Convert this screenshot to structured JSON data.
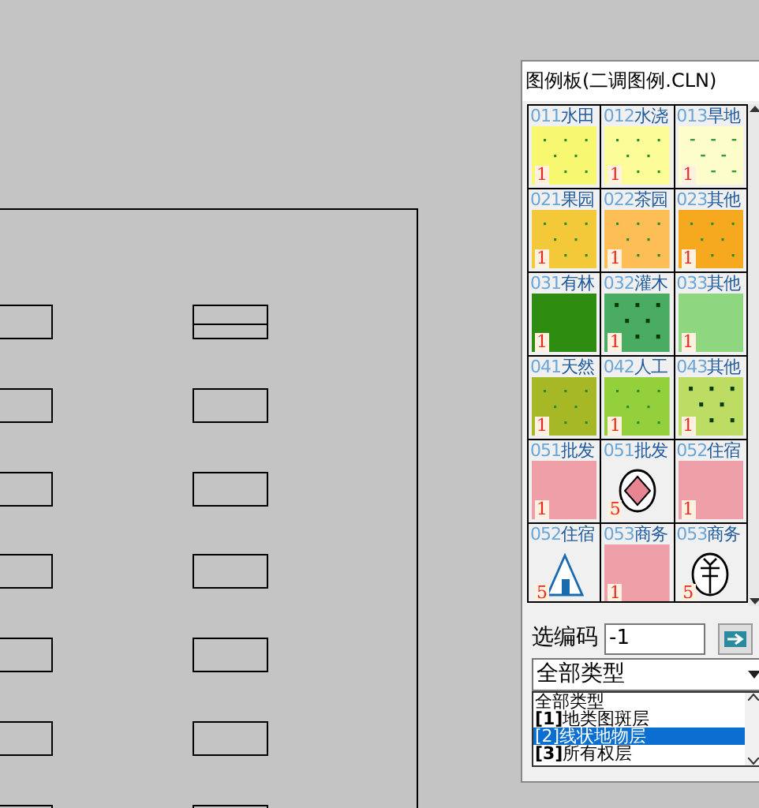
{
  "panel": {
    "title": "图例板(二调图例.CLN)",
    "cells": [
      {
        "code": "011",
        "name": "水田",
        "kind": "dots",
        "color": "#f8f870",
        "mark": "1"
      },
      {
        "code": "012",
        "name": "水浇",
        "kind": "dots",
        "color": "#fbfb98",
        "mark": "1"
      },
      {
        "code": "013",
        "name": "旱地",
        "kind": "dashes",
        "color": "#fdfdcc",
        "mark": "1"
      },
      {
        "code": "021",
        "name": "果园",
        "kind": "dots",
        "color": "#f3c93a",
        "mark": "1"
      },
      {
        "code": "022",
        "name": "茶园",
        "kind": "dots",
        "color": "#fcbe55",
        "mark": "1"
      },
      {
        "code": "023",
        "name": "其他",
        "kind": "dots",
        "color": "#f6a91e",
        "mark": "1"
      },
      {
        "code": "031",
        "name": "有林",
        "kind": "plain",
        "color": "#2e8c10",
        "mark": "1"
      },
      {
        "code": "032",
        "name": "灌木",
        "kind": "big-dots",
        "color": "#4aab62",
        "mark": "1"
      },
      {
        "code": "033",
        "name": "其他",
        "kind": "plain",
        "color": "#8fd681",
        "mark": "1"
      },
      {
        "code": "041",
        "name": "天然",
        "kind": "dots",
        "color": "#a6b826",
        "mark": "1"
      },
      {
        "code": "042",
        "name": "人工",
        "kind": "dots",
        "color": "#94d03c",
        "mark": "1"
      },
      {
        "code": "043",
        "name": "其他",
        "kind": "big-dots",
        "color": "#bcdc64",
        "mark": "1"
      },
      {
        "code": "051",
        "name": "批发",
        "kind": "plain",
        "color": "#ef9fa8",
        "mark": "1"
      },
      {
        "code": "051",
        "name": "批发",
        "kind": "diamond",
        "mark": "5"
      },
      {
        "code": "052",
        "name": "住宿",
        "kind": "plain",
        "color": "#ef9fa8",
        "mark": "1"
      },
      {
        "code": "052",
        "name": "住宿",
        "kind": "tent",
        "mark": "5"
      },
      {
        "code": "053",
        "name": "商务",
        "kind": "plain",
        "color": "#ef9fa8",
        "mark": "1"
      },
      {
        "code": "053",
        "name": "商务",
        "kind": "circled",
        "mark": "5"
      }
    ],
    "code_label": "选编码",
    "code_value": "-1",
    "type_value": "全部类型",
    "type_options": [
      {
        "label": "全部类型",
        "selected": false
      },
      {
        "label": "**[1]**地类图斑层",
        "selected": false
      },
      {
        "label": "[2]线状地物层",
        "selected": true
      },
      {
        "label": "**[3]**所有权层",
        "selected": false
      }
    ]
  }
}
